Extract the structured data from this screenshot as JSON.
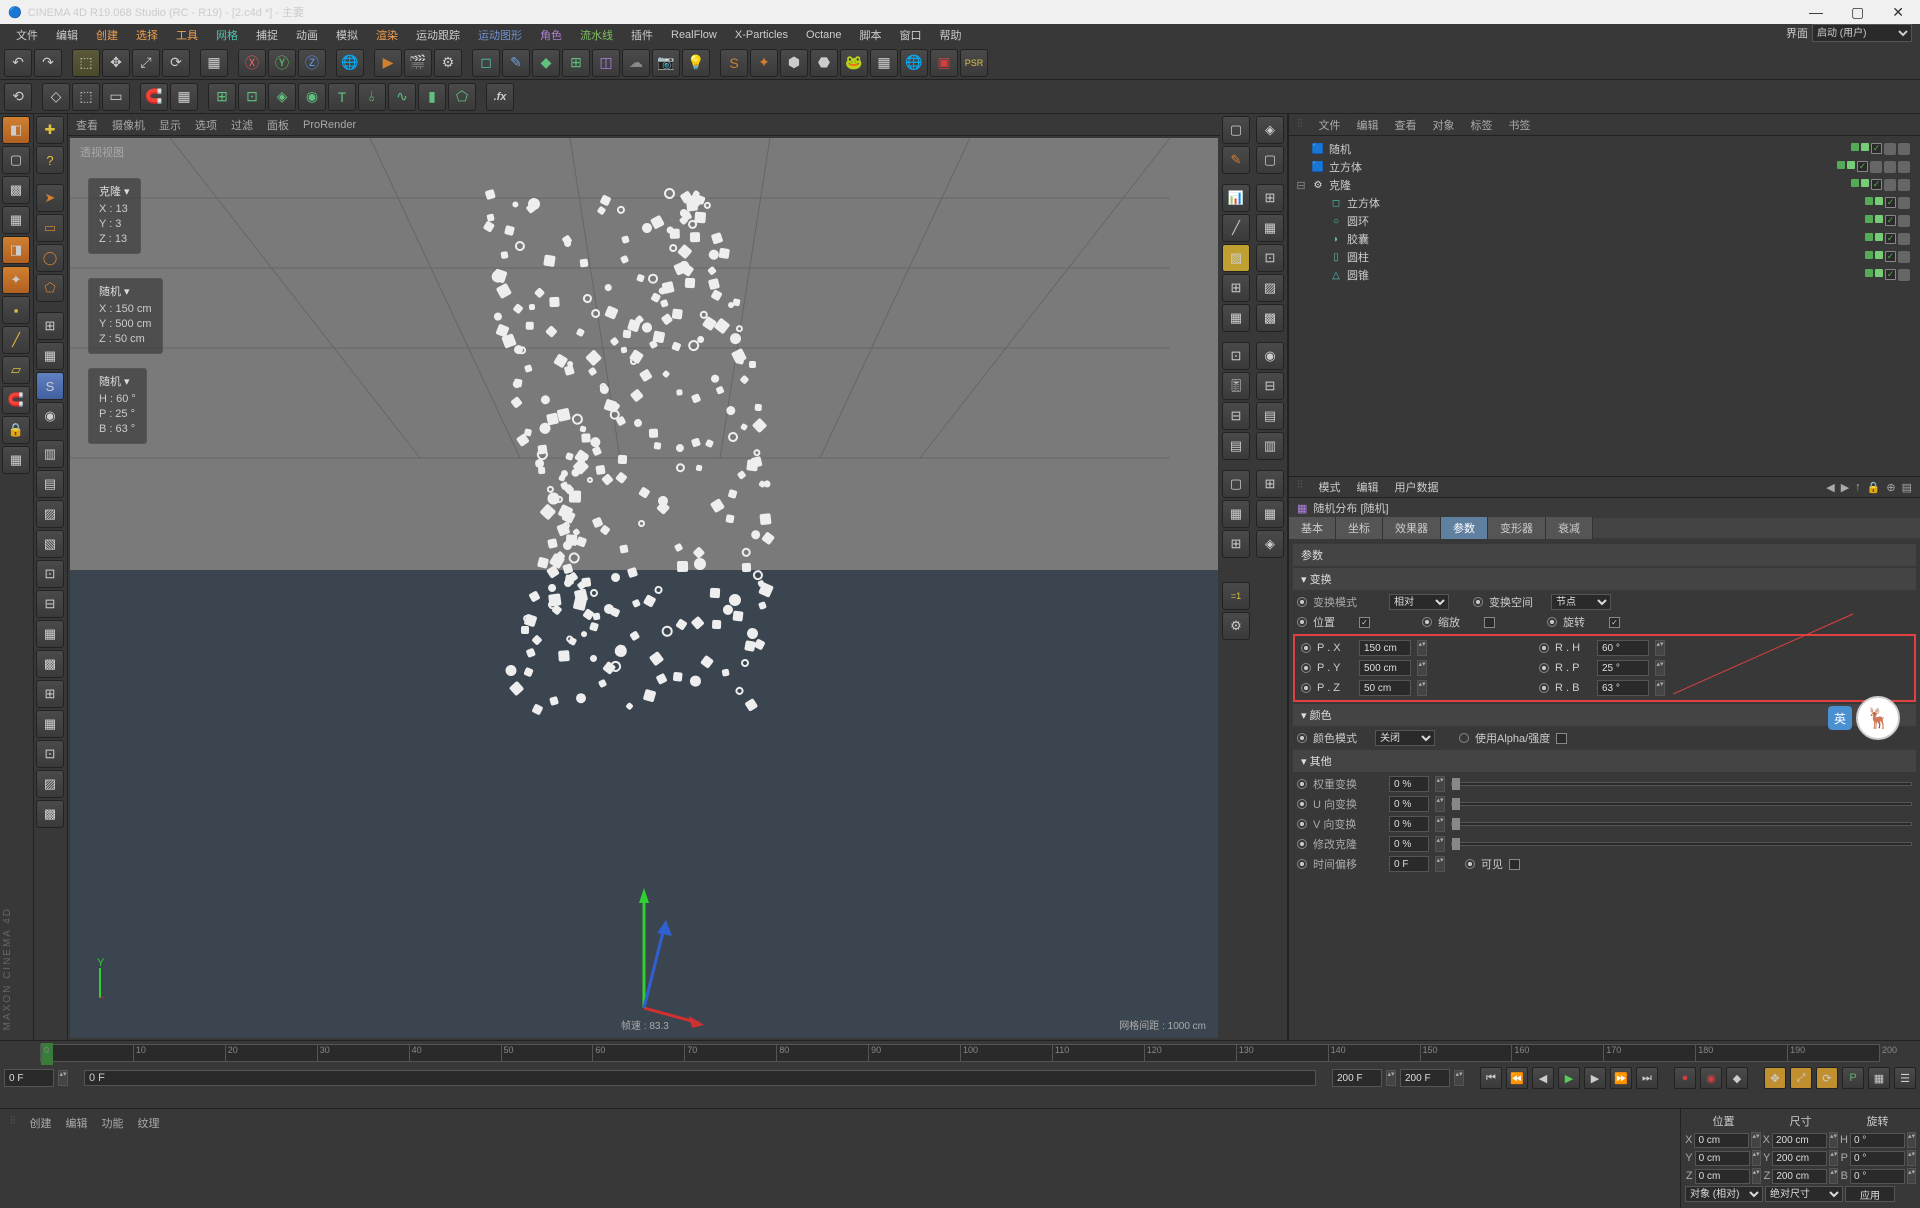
{
  "app": {
    "title": "CINEMA 4D R19.068 Studio (RC - R19) - [2.c4d *] - 主要",
    "layout_label": "界面",
    "layout_value": "启动 (用户)"
  },
  "menubar": [
    {
      "t": "文件",
      "c": ""
    },
    {
      "t": "编辑",
      "c": ""
    },
    {
      "t": "创建",
      "c": "orange"
    },
    {
      "t": "选择",
      "c": "orange"
    },
    {
      "t": "工具",
      "c": "orange"
    },
    {
      "t": "网格",
      "c": "teal"
    },
    {
      "t": "捕捉",
      "c": ""
    },
    {
      "t": "动画",
      "c": ""
    },
    {
      "t": "模拟",
      "c": ""
    },
    {
      "t": "渲染",
      "c": "orange"
    },
    {
      "t": "运动跟踪",
      "c": ""
    },
    {
      "t": "运动图形",
      "c": "blue"
    },
    {
      "t": "角色",
      "c": "purple"
    },
    {
      "t": "流水线",
      "c": "green"
    },
    {
      "t": "插件",
      "c": ""
    },
    {
      "t": "RealFlow",
      "c": ""
    },
    {
      "t": "X-Particles",
      "c": ""
    },
    {
      "t": "Octane",
      "c": ""
    },
    {
      "t": "脚本",
      "c": ""
    },
    {
      "t": "窗口",
      "c": ""
    },
    {
      "t": "帮助",
      "c": ""
    }
  ],
  "vpmenu": [
    "查看",
    "摄像机",
    "显示",
    "选项",
    "过滤",
    "面板",
    "ProRender"
  ],
  "vp": {
    "label": "透视视图",
    "hud1": {
      "title": "克隆 ▾",
      "x": "X : 13",
      "y": "Y : 3",
      "z": "Z : 13"
    },
    "hud2": {
      "title": "随机 ▾",
      "x": "X : 150 cm",
      "y": "Y : 500 cm",
      "z": "Z : 50 cm"
    },
    "hud3": {
      "title": "随机 ▾",
      "h": "H : 60 °",
      "p": "P : 25 °",
      "b": "B : 63 °"
    },
    "fps": "帧速 : 83.3",
    "grid": "网格间距 : 1000 cm"
  },
  "objmgr": {
    "menu": [
      "文件",
      "编辑",
      "查看",
      "对象",
      "标签",
      "书签"
    ],
    "tree": [
      {
        "lvl": 0,
        "ico": "🟦",
        "col": "#b080e0",
        "name": "随机",
        "exp": "",
        "tags": 2
      },
      {
        "lvl": 0,
        "ico": "🟦",
        "col": "#50c0b0",
        "name": "立方体",
        "exp": "",
        "tags": 3
      },
      {
        "lvl": 0,
        "ico": "⚙",
        "col": "#ddd",
        "name": "克隆",
        "exp": "⊟",
        "tags": 2
      },
      {
        "lvl": 1,
        "ico": "◻",
        "col": "#50c0b0",
        "name": "立方体",
        "exp": "",
        "tags": 1
      },
      {
        "lvl": 1,
        "ico": "○",
        "col": "#50c0b0",
        "name": "圆环",
        "exp": "",
        "tags": 1
      },
      {
        "lvl": 1,
        "ico": "◗",
        "col": "#50c0b0",
        "name": "胶囊",
        "exp": "",
        "tags": 1
      },
      {
        "lvl": 1,
        "ico": "▯",
        "col": "#50c0b0",
        "name": "圆柱",
        "exp": "",
        "tags": 1
      },
      {
        "lvl": 1,
        "ico": "△",
        "col": "#50c0b0",
        "name": "圆锥",
        "exp": "",
        "tags": 1
      }
    ]
  },
  "attr": {
    "menu": [
      "模式",
      "编辑",
      "用户数据"
    ],
    "title": "随机分布 [随机]",
    "tabs": [
      "基本",
      "坐标",
      "效果器",
      "参数",
      "变形器",
      "衰减"
    ],
    "active_tab": "参数",
    "sect_params": "参数",
    "sect_transform": "▾ 变换",
    "transform_mode_lbl": "变换模式",
    "transform_mode_val": "相对",
    "transform_space_lbl": "变换空间",
    "transform_space_val": "节点",
    "position_lbl": "位置",
    "scale_lbl": "缩放",
    "rotation_lbl": "旋转",
    "px_lbl": "P . X",
    "px_val": "150 cm",
    "rh_lbl": "R . H",
    "rh_val": "60 °",
    "py_lbl": "P . Y",
    "py_val": "500 cm",
    "rp_lbl": "R . P",
    "rp_val": "25 °",
    "pz_lbl": "P . Z",
    "pz_val": "50 cm",
    "rb_lbl": "R . B",
    "rb_val": "63 °",
    "sect_color": "▾ 颜色",
    "colormode_lbl": "颜色模式",
    "colormode_val": "关闭",
    "alpha_lbl": "使用Alpha/强度",
    "sect_other": "▾ 其他",
    "weight_lbl": "权重变换",
    "weight_val": "0 %",
    "uvar_lbl": "U 向变换",
    "uvar_val": "0 %",
    "vvar_lbl": "V 向变换",
    "vvar_val": "0 %",
    "modclone_lbl": "修改克隆",
    "modclone_val": "0 %",
    "timeoff_lbl": "时间偏移",
    "timeoff_val": "0 F",
    "visible_lbl": "可见"
  },
  "timeline": {
    "start": "0 F",
    "scrub": "0 F",
    "end": "200 F",
    "end2": "200 F",
    "marks": [
      "0",
      "10",
      "20",
      "30",
      "40",
      "50",
      "60",
      "70",
      "80",
      "90",
      "100",
      "110",
      "120",
      "130",
      "140",
      "150",
      "160",
      "170",
      "180",
      "190",
      "200"
    ]
  },
  "matmenu": [
    "创建",
    "编辑",
    "功能",
    "纹理"
  ],
  "coord": {
    "hdr": [
      "位置",
      "尺寸",
      "旋转"
    ],
    "rows": [
      {
        "a": "X",
        "v1": "0 cm",
        "b": "X",
        "v2": "200 cm",
        "c": "H",
        "v3": "0 °"
      },
      {
        "a": "Y",
        "v1": "0 cm",
        "b": "Y",
        "v2": "200 cm",
        "c": "P",
        "v3": "0 °"
      },
      {
        "a": "Z",
        "v1": "0 cm",
        "b": "Z",
        "v2": "200 cm",
        "c": "B",
        "v3": "0 °"
      }
    ],
    "obj_lbl": "对象 (相对)",
    "size_lbl": "绝对尺寸",
    "apply": "应用"
  },
  "maxon": "MAXON CINEMA 4D"
}
